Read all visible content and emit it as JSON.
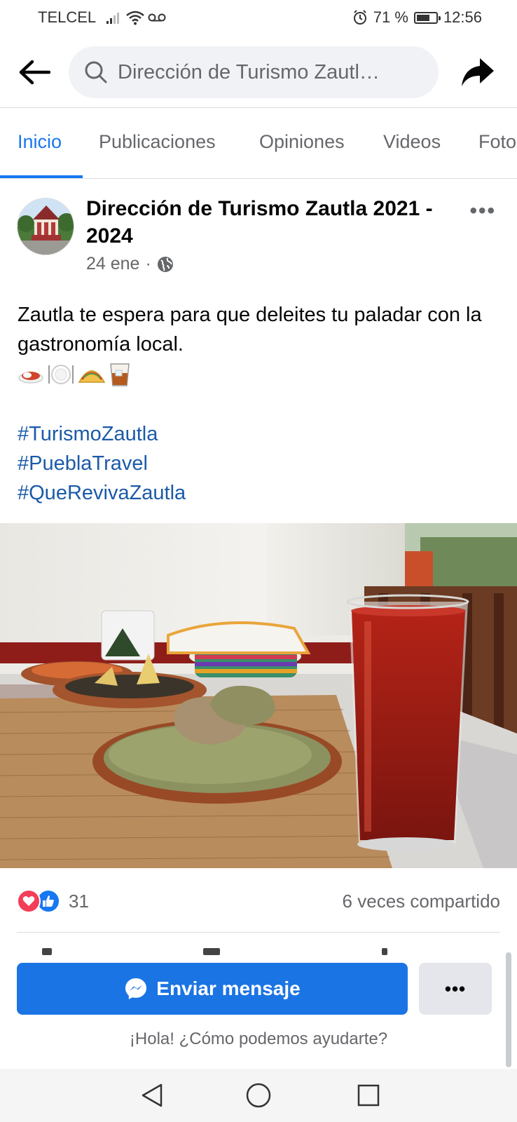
{
  "status_bar": {
    "carrier": "TELCEL",
    "battery_percent_text": "71 %",
    "battery_level": 0.71,
    "time": "12:56"
  },
  "header": {
    "search_text": "Dirección de Turismo Zautl…"
  },
  "tabs": [
    {
      "label": "Inicio",
      "active": true
    },
    {
      "label": "Publicaciones",
      "active": false
    },
    {
      "label": "Opiniones",
      "active": false
    },
    {
      "label": "Videos",
      "active": false
    },
    {
      "label": "Fotos",
      "active": false
    }
  ],
  "post": {
    "page_name": "Dirección de Turismo Zautla 2021 - 2024",
    "date": "24 ene",
    "separator": "·",
    "privacy_icon": "globe-icon",
    "text_line": "Zautla te espera para que deleites tu paladar con la gastronomía local.",
    "emojis": [
      "🍛",
      "🍽️",
      "🌮",
      "🥃"
    ],
    "hashtags": [
      "#TurismoZautla",
      "#PueblaTravel",
      "#QueRevivaZautla"
    ],
    "photo_alt_icon": "food-photo"
  },
  "engagement": {
    "reaction_count": "31",
    "shares": "6 veces compartido"
  },
  "cta": {
    "send_label": "Enviar mensaje",
    "more_label": "•••",
    "greeting": "¡Hola! ¿Cómo podemos ayudarte?"
  },
  "colors": {
    "facebook_blue": "#1877f2",
    "hashtag": "#1b5aa8",
    "send_button": "#1b74e4",
    "love": "#f33e58"
  }
}
